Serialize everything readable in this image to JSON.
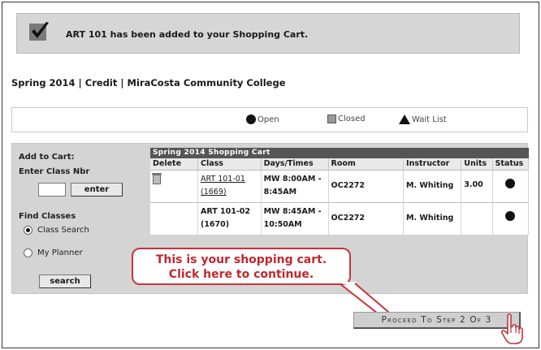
{
  "message": {
    "text": "ART 101 has been added to your Shopping Cart."
  },
  "term": {
    "text": "Spring 2014 | Credit | MiraCosta Community College"
  },
  "legend": {
    "open": "Open",
    "closed": "Closed",
    "waitlist": "Wait List"
  },
  "left": {
    "add_to_cart": "Add to Cart:",
    "enter_class_nbr": "Enter Class Nbr",
    "class_nbr_value": "",
    "enter_button": "enter",
    "find_classes": "Find Classes",
    "class_search": "Class Search",
    "my_planner": "My Planner",
    "search_button": "search"
  },
  "cart": {
    "title": "Spring 2014 Shopping Cart",
    "columns": [
      "Delete",
      "Class",
      "Days/Times",
      "Room",
      "Instructor",
      "Units",
      "Status"
    ],
    "rows": [
      {
        "class": "ART 101-01",
        "class_nbr": "(1669)",
        "days_times_1": "MW 8:00AM -",
        "days_times_2": "8:45AM",
        "room": "OC2272",
        "instructor": "M. Whiting",
        "units": "3.00"
      },
      {
        "class": "ART 101-02",
        "class_nbr": "(1670)",
        "days_times_1": "MW 8:45AM -",
        "days_times_2": "10:50AM",
        "room": "OC2272",
        "instructor": "M. Whiting",
        "units": ""
      }
    ]
  },
  "callout": {
    "line1": "This is your shopping cart.",
    "line2": "Click here to continue."
  },
  "proceed": {
    "label": "Proceed To Step 2 Of 3"
  },
  "colors": {
    "callout_red": "#c8323c",
    "panel_gray": "#d4d4d4",
    "header_dark": "#555555"
  }
}
